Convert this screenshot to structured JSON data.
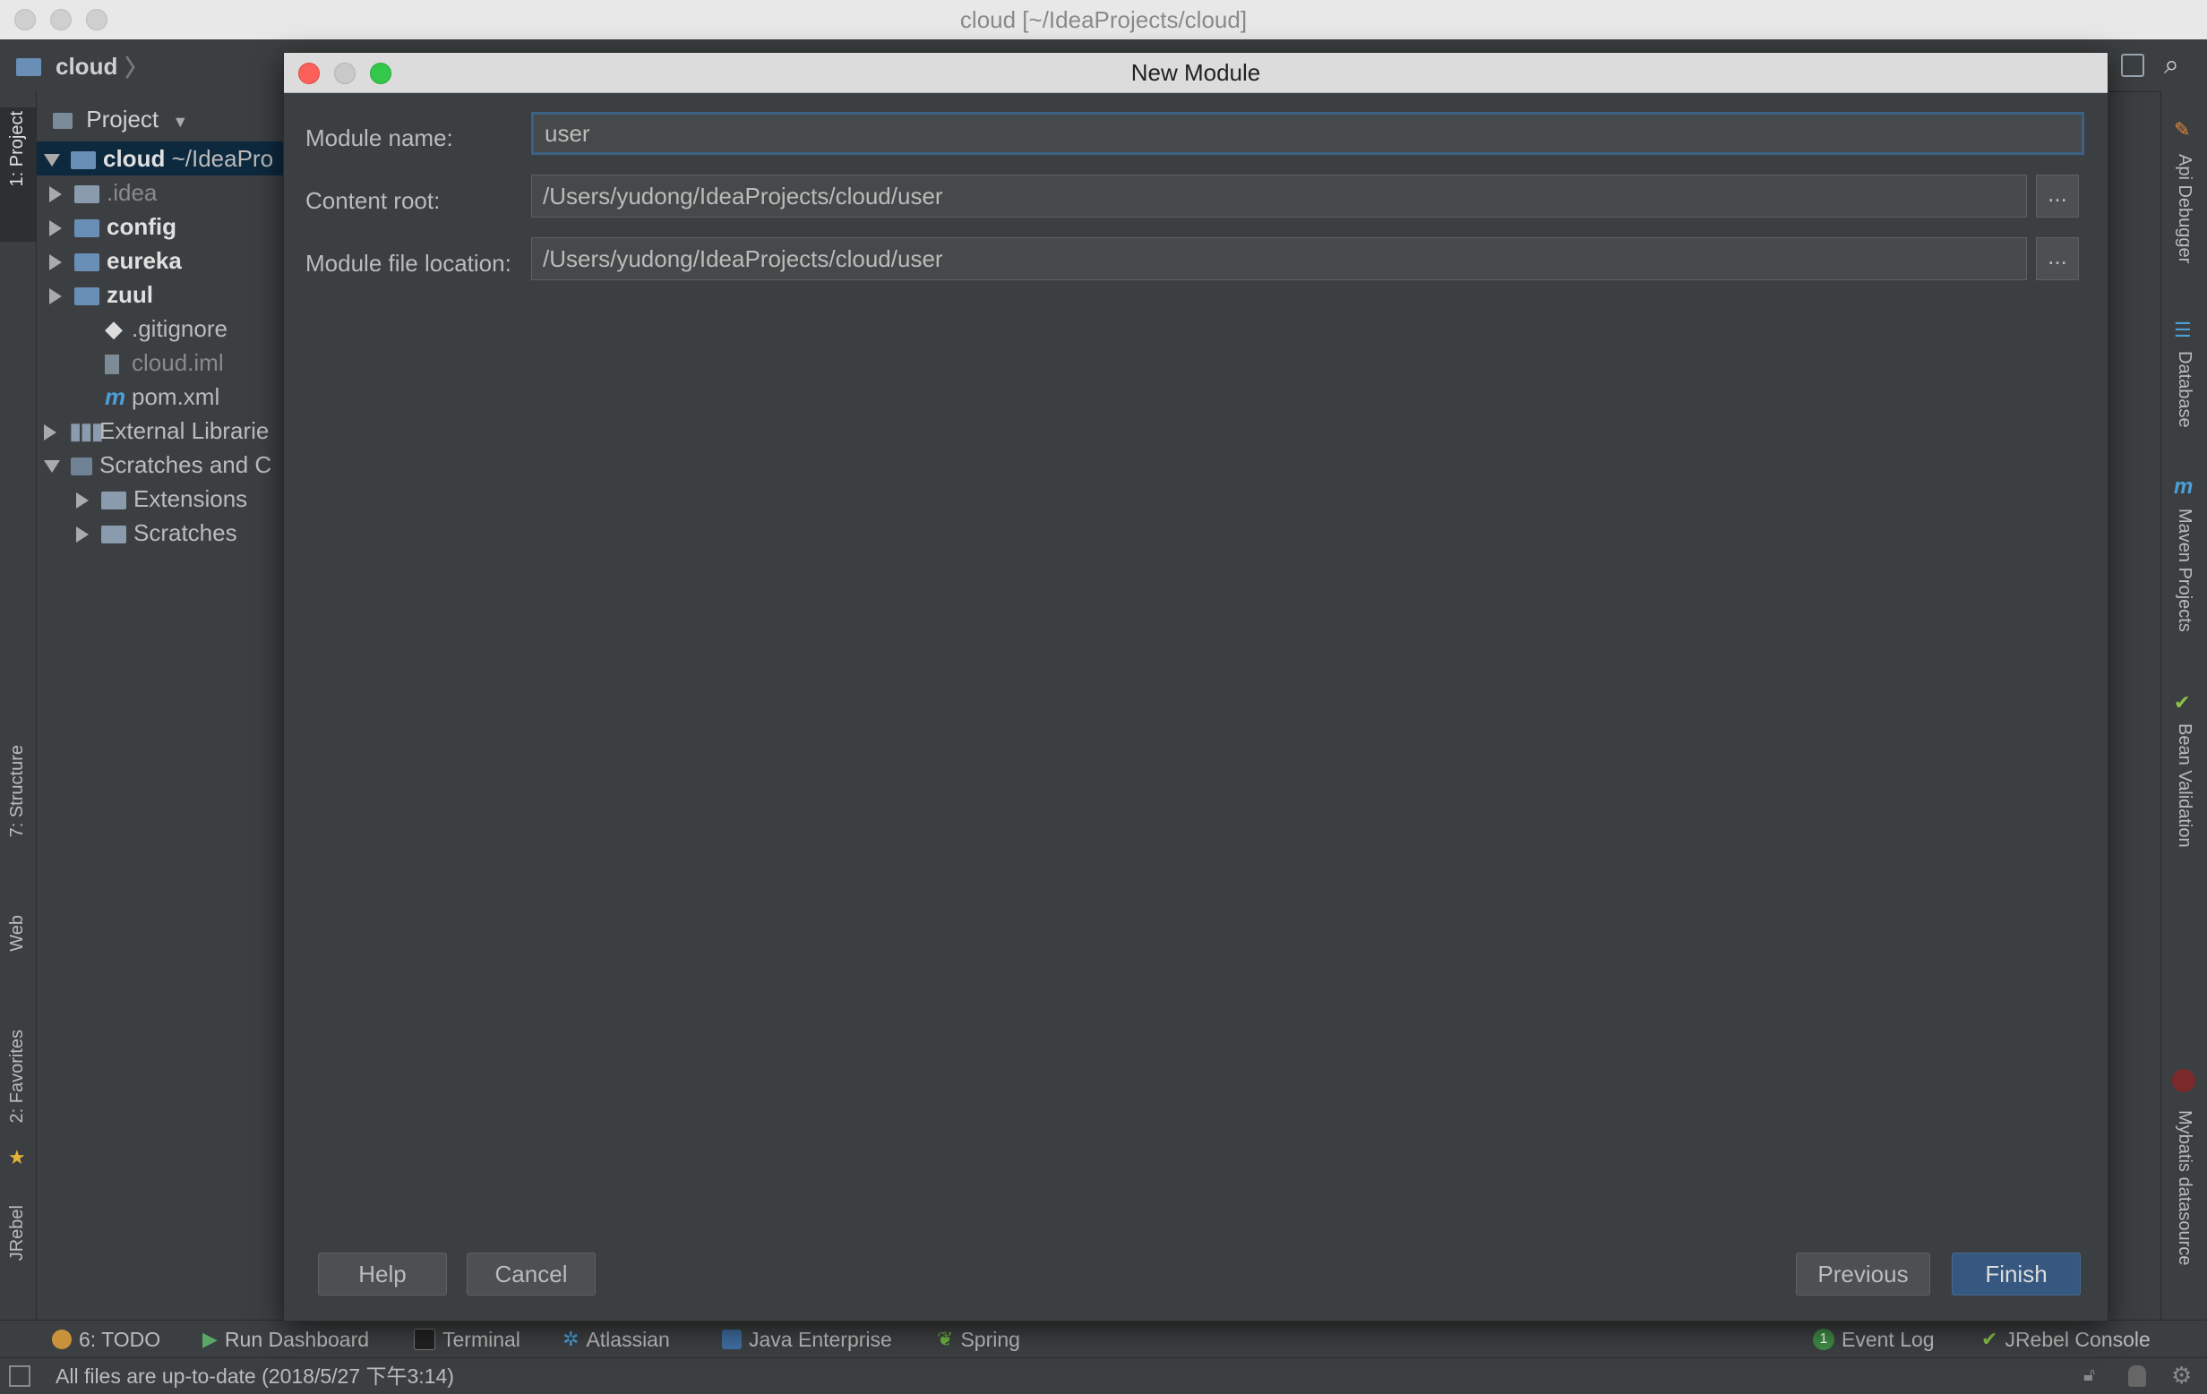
{
  "window": {
    "title": "cloud [~/IdeaProjects/cloud]"
  },
  "navbar": {
    "crumb": "cloud"
  },
  "left_stripe": {
    "tabs": [
      "1: Project",
      "7: Structure",
      "Web",
      "2: Favorites",
      "JRebel"
    ]
  },
  "project_panel": {
    "header": "Project",
    "tree": [
      {
        "label": "cloud",
        "suffix": "~/IdeaPro",
        "depth": 0,
        "expanded": true,
        "selected": true,
        "style": "bold"
      },
      {
        "label": ".idea",
        "depth": 1,
        "expanded": false,
        "style": "dim"
      },
      {
        "label": "config",
        "depth": 1,
        "expanded": false,
        "style": "bold"
      },
      {
        "label": "eureka",
        "depth": 1,
        "expanded": false,
        "style": "bold"
      },
      {
        "label": "zuul",
        "depth": 1,
        "expanded": false,
        "style": "bold"
      },
      {
        "label": ".gitignore",
        "depth": 1,
        "style": "normal"
      },
      {
        "label": "cloud.iml",
        "depth": 1,
        "style": "dim"
      },
      {
        "label": "pom.xml",
        "depth": 1,
        "style": "normal"
      },
      {
        "label": "External Librarie",
        "depth": 0,
        "expanded": false,
        "style": "normal"
      },
      {
        "label": "Scratches and C",
        "depth": 0,
        "expanded": true,
        "style": "normal"
      },
      {
        "label": "Extensions",
        "depth": 1,
        "expanded": false,
        "style": "normal"
      },
      {
        "label": "Scratches",
        "depth": 1,
        "expanded": false,
        "style": "normal"
      }
    ]
  },
  "right_stripe": {
    "tabs": [
      "Api Debugger",
      "Database",
      "Maven Projects",
      "Bean Validation",
      "Mybatis datasource"
    ]
  },
  "dialog": {
    "title": "New Module",
    "module_name_label": "Module name:",
    "module_name_value": "user",
    "content_root_label": "Content root:",
    "content_root_value": "/Users/yudong/IdeaProjects/cloud/user",
    "module_file_label": "Module file location:",
    "module_file_value": "/Users/yudong/IdeaProjects/cloud/user",
    "browse_label": "...",
    "help_label": "Help",
    "cancel_label": "Cancel",
    "previous_label": "Previous",
    "finish_label": "Finish"
  },
  "bottom_bar": {
    "todo": "6: TODO",
    "run_dashboard": "Run Dashboard",
    "terminal": "Terminal",
    "atlassian": "Atlassian",
    "java_enterprise": "Java Enterprise",
    "spring": "Spring",
    "event_log_count": "1",
    "event_log": "Event Log",
    "jrebel_console": "JRebel Console"
  },
  "status_bar": {
    "text": "All files are up-to-date (2018/5/27 下午3:14)"
  },
  "colors": {
    "accent": "#365880",
    "selection": "#0d293e",
    "background": "#3c3f41"
  }
}
